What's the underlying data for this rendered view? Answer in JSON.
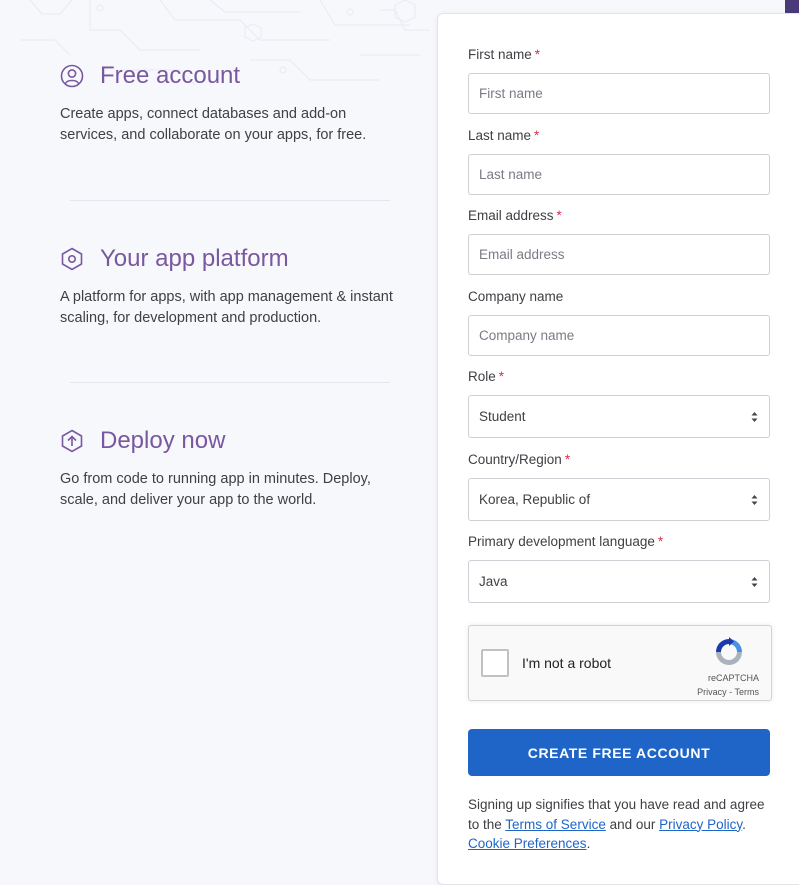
{
  "features": [
    {
      "icon": "user-circle-icon",
      "title": "Free account",
      "description": "Create apps, connect databases and add-on services, and collaborate on your apps, for free."
    },
    {
      "icon": "hexagon-icon",
      "title": "Your app platform",
      "description": "A platform for apps, with app management & instant scaling, for development and production."
    },
    {
      "icon": "upload-arrow-icon",
      "title": "Deploy now",
      "description": "Go from code to running app in minutes. Deploy, scale, and deliver your app to the world."
    }
  ],
  "form": {
    "first_name": {
      "label": "First name",
      "required": "*",
      "placeholder": "First name"
    },
    "last_name": {
      "label": "Last name",
      "required": "*",
      "placeholder": "Last name"
    },
    "email": {
      "label": "Email address",
      "required": "*",
      "placeholder": "Email address"
    },
    "company": {
      "label": "Company name",
      "placeholder": "Company name"
    },
    "role": {
      "label": "Role",
      "required": "*",
      "value": "Student"
    },
    "country": {
      "label": "Country/Region",
      "required": "*",
      "value": "Korea, Republic of"
    },
    "language": {
      "label": "Primary development language",
      "required": "*",
      "value": "Java"
    }
  },
  "captcha": {
    "label": "I'm not a robot",
    "brand": "reCAPTCHA",
    "privacy": "Privacy",
    "separator": " - ",
    "terms": "Terms"
  },
  "submit_label": "CREATE FREE ACCOUNT",
  "legal": {
    "prefix": "Signing up signifies that you have read and agree to the ",
    "terms_link": "Terms of Service",
    "middle": " and our ",
    "privacy_link": "Privacy Policy",
    "period": ".",
    "cookie_link": "Cookie Preferences",
    "end": "."
  },
  "colors": {
    "accent_purple": "#79589f",
    "button_blue": "#1f65c8",
    "required_red": "#d6304a"
  }
}
